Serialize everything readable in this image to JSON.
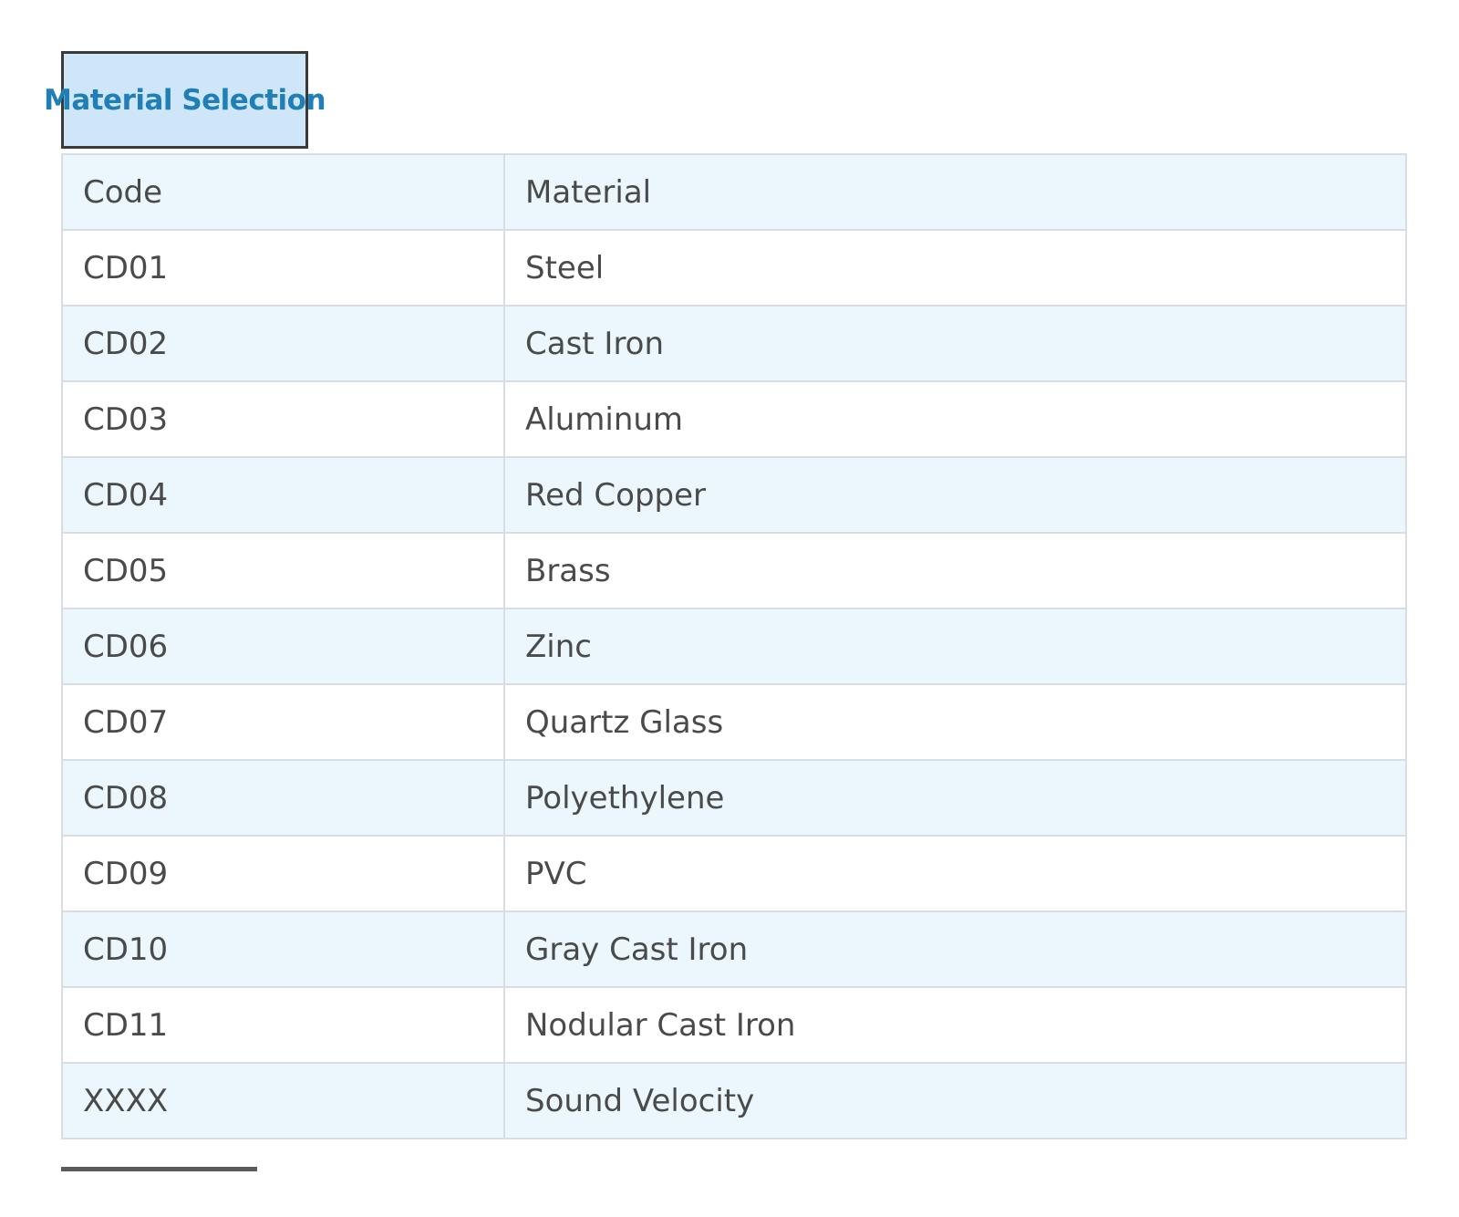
{
  "tab": {
    "label": "Material Selection"
  },
  "table": {
    "headers": [
      "Code",
      "Material"
    ],
    "rows": [
      [
        "CD01",
        "Steel"
      ],
      [
        "CD02",
        "Cast Iron"
      ],
      [
        "CD03",
        "Aluminum"
      ],
      [
        "CD04",
        "Red Copper"
      ],
      [
        "CD05",
        "Brass"
      ],
      [
        "CD06",
        "Zinc"
      ],
      [
        "CD07",
        "Quartz Glass"
      ],
      [
        "CD08",
        "Polyethylene"
      ],
      [
        "CD09",
        "PVC"
      ],
      [
        "CD10",
        "Gray Cast Iron"
      ],
      [
        "CD11",
        "Nodular Cast Iron"
      ],
      [
        "XXXX",
        "Sound Velocity"
      ]
    ]
  },
  "colors": {
    "tab_background": "#cfe6f9",
    "tab_text": "#1f7fb6",
    "row_alt_background": "#ebf7fd",
    "text": "#4a4a4a"
  }
}
